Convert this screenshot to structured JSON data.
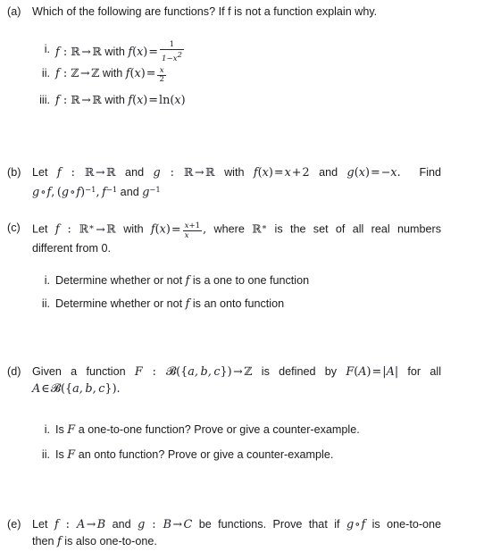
{
  "document": {
    "kind": "math-problem-set",
    "topic": "functions",
    "background_color": "#ffffff",
    "text_color": "#1b1b1f"
  },
  "problems": [
    {
      "label": "(a)",
      "name": "problem-a",
      "prompt": "Which of the following are functions? If f is not a function explain why.",
      "subitems": [
        {
          "numeral": "i.",
          "name": "problem-a-item-i"
        },
        {
          "numeral": "ii.",
          "name": "problem-a-item-ii"
        },
        {
          "numeral": "iii.",
          "name": "problem-a-item-iii"
        }
      ],
      "math": {
        "i": {
          "domain": "R",
          "codomain": "R",
          "formula": "1/(1-x^2)",
          "numerator": "1",
          "denominator": "1-x²"
        },
        "ii": {
          "domain": "Z",
          "codomain": "Z",
          "formula": "x/2",
          "numerator": "x",
          "denominator": "2"
        },
        "iii": {
          "domain": "R",
          "codomain": "R",
          "formula": "ln(x)"
        }
      }
    },
    {
      "label": "(b)",
      "name": "problem-b",
      "line1_words": {
        "w1": "Let",
        "w2": "and",
        "w3": "with",
        "w4": "and",
        "w5": "Find"
      },
      "line2_words": {
        "w1": "and"
      },
      "math": {
        "f_map": "f : R → R",
        "g_map": "g : R → R",
        "fx": "f(x) = x + 2",
        "gx": "g(x) = −x",
        "find": "g∘f, (g∘f)⁻¹, f⁻¹ and g⁻¹"
      }
    },
    {
      "label": "(c)",
      "name": "problem-c",
      "line1_words": {
        "w1": "Let",
        "w2": "with",
        "w3": ", where",
        "w4": "is the set of all real numbers"
      },
      "line2": "different from 0.",
      "math": {
        "map": "f : R* → R",
        "formula": "(x+1)/x",
        "numerator": "x+1",
        "denominator": "x"
      },
      "subitems": [
        {
          "numeral": "i.",
          "name": "problem-c-item-i",
          "text_before": "Determine whether or not",
          "text_after": "is a one to one function"
        },
        {
          "numeral": "ii.",
          "name": "problem-c-item-ii",
          "text_before": "Determine whether or not",
          "text_after": "is an onto function"
        }
      ]
    },
    {
      "label": "(d)",
      "name": "problem-d",
      "line1_words": {
        "w1": "Given a function",
        "w2": "is defined by",
        "w3": "for all"
      },
      "math": {
        "map": "F : P({a,b,c}) → Z",
        "definition": "F(A) = |A|",
        "membership": "A ∈ P({a, b, c})."
      },
      "subitems": [
        {
          "numeral": "i.",
          "name": "problem-d-item-i",
          "text_before": "Is",
          "text_after": "a one-to-one function? Prove or give a counter-example."
        },
        {
          "numeral": "ii.",
          "name": "problem-d-item-ii",
          "text_before": "Is",
          "text_after": "an onto function? Prove or give a counter-example."
        }
      ]
    },
    {
      "label": "(e)",
      "name": "problem-e",
      "line1_words": {
        "w1": "Let",
        "w2": "and",
        "w3": "be functions. Prove that if",
        "w4": "is one-to-one"
      },
      "line2_words": {
        "w1": "then",
        "w2": "is also one-to-one."
      },
      "math": {
        "f_map": "f : A → B",
        "g_map": "g : B → C",
        "composition": "g∘f"
      }
    }
  ],
  "symbols": {
    "reals": "ℝ",
    "integers": "ℤ",
    "powerset": "𝒫",
    "arrow": "→",
    "compose": "∘",
    "element_of": "∈",
    "minus": "−"
  }
}
